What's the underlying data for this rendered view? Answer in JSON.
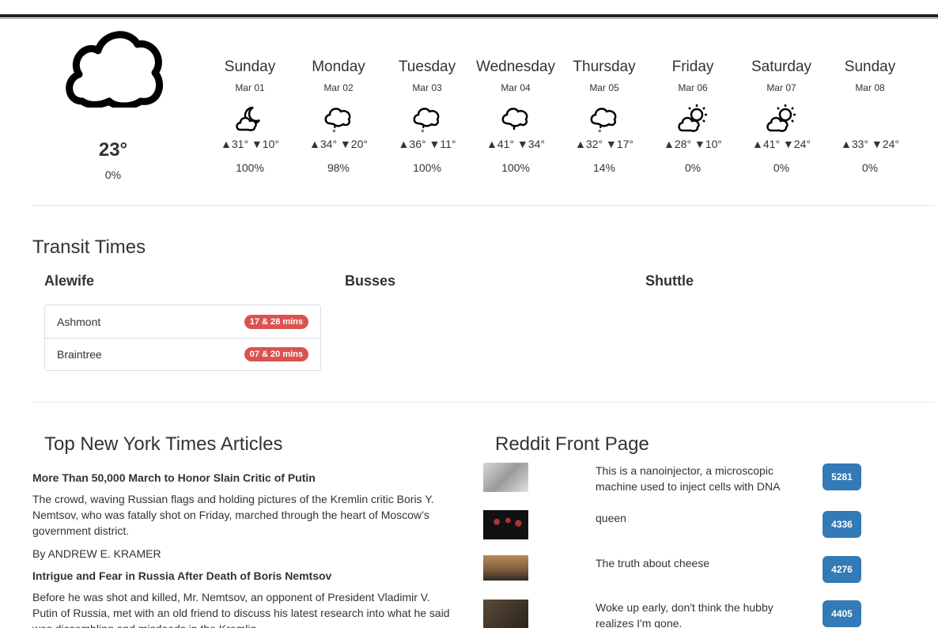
{
  "current": {
    "icon": "cloud-icon",
    "temperature": "23°",
    "precip": "0%"
  },
  "forecast": [
    {
      "day": "Sunday",
      "date": "Mar 01",
      "icon": "partly-cloudy-night-icon",
      "temps": "▲31° ▼10°",
      "precip": "100%"
    },
    {
      "day": "Monday",
      "date": "Mar 02",
      "icon": "snow-icon",
      "temps": "▲34° ▼20°",
      "precip": "98%"
    },
    {
      "day": "Tuesday",
      "date": "Mar 03",
      "icon": "snow-icon",
      "temps": "▲36° ▼11°",
      "precip": "100%"
    },
    {
      "day": "Wednesday",
      "date": "Mar 04",
      "icon": "rain-icon",
      "temps": "▲41° ▼34°",
      "precip": "100%"
    },
    {
      "day": "Thursday",
      "date": "Mar 05",
      "icon": "snow-icon",
      "temps": "▲32° ▼17°",
      "precip": "14%"
    },
    {
      "day": "Friday",
      "date": "Mar 06",
      "icon": "partly-cloudy-day-icon",
      "temps": "▲28° ▼10°",
      "precip": "0%"
    },
    {
      "day": "Saturday",
      "date": "Mar 07",
      "icon": "partly-cloudy-day-icon",
      "temps": "▲41° ▼24°",
      "precip": "0%"
    },
    {
      "day": "Sunday",
      "date": "Mar 08",
      "icon": "",
      "temps": "▲33° ▼24°",
      "precip": "0%"
    }
  ],
  "transit": {
    "title": "Transit Times",
    "columns": [
      "Alewife",
      "Busses",
      "Shuttle"
    ],
    "alewife": [
      {
        "name": "Ashmont",
        "time": "17 & 28 mins"
      },
      {
        "name": "Braintree",
        "time": "07 & 20 mins"
      }
    ]
  },
  "nyt": {
    "title": "Top New York Times Articles",
    "articles": [
      {
        "headline": "More Than 50,000 March to Honor Slain Critic of Putin",
        "abstract": "The crowd, waving Russian flags and holding pictures of the Kremlin critic Boris Y. Nemtsov, who was fatally shot on Friday, marched through the heart of Moscow’s government district.",
        "byline": "By ANDREW E. KRAMER"
      },
      {
        "headline": "Intrigue and Fear in Russia After Death of Boris Nemtsov",
        "abstract": "Before he was shot and killed, Mr. Nemtsov, an opponent of President Vladimir V. Putin of Russia, met with an old friend to discuss his latest research into what he said was dissembling and misdeeds in the Kremlin."
      }
    ]
  },
  "reddit": {
    "title": "Reddit Front Page",
    "posts": [
      {
        "title": "This is a nanoinjector, a microscopic machine used to inject cells with DNA",
        "score": "5281"
      },
      {
        "title": "queen",
        "score": "4336"
      },
      {
        "title": "The truth about cheese",
        "score": "4276"
      },
      {
        "title": "Woke up early, don't think the hubby realizes I'm gone.",
        "score": "4405"
      }
    ]
  }
}
